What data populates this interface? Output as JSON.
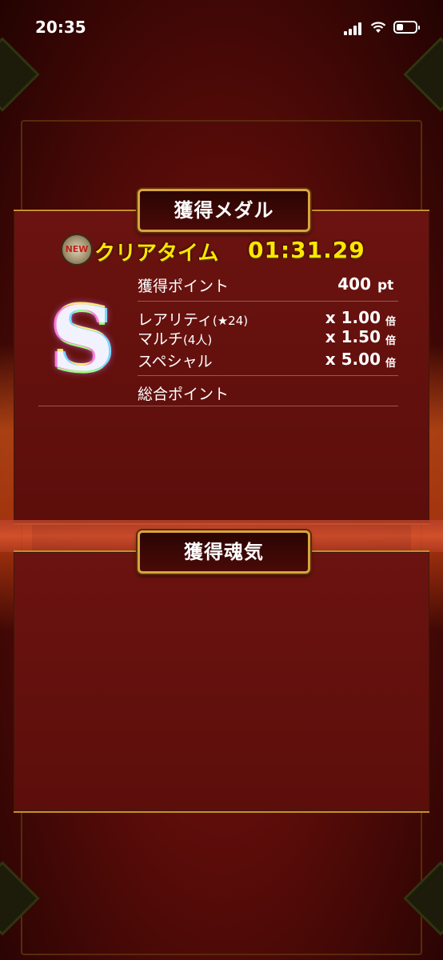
{
  "status_bar": {
    "time": "20:35"
  },
  "medal_section": {
    "title": "獲得メダル",
    "new_badge": "NEW",
    "clear_label": "クリアタイム",
    "clear_time": "01:31.29",
    "rank": "S",
    "points_label": "獲得ポイント",
    "points_value": "400",
    "points_unit": "pt",
    "multipliers": [
      {
        "label": "レアリティ",
        "detail": "(★24)",
        "value": "x 1.00",
        "unit": "倍"
      },
      {
        "label": "マルチ",
        "detail": "(4人)",
        "value": "x 1.50",
        "unit": "倍"
      },
      {
        "label": "スペシャル",
        "detail": "",
        "value": "x 5.00",
        "unit": "倍"
      }
    ],
    "total_label": "総合ポイント"
  },
  "soul_section": {
    "title": "獲得魂気"
  },
  "colors": {
    "accent_gold": "#d9a33e",
    "highlight_yellow": "#ffe600",
    "panel_red": "#6b1310"
  }
}
